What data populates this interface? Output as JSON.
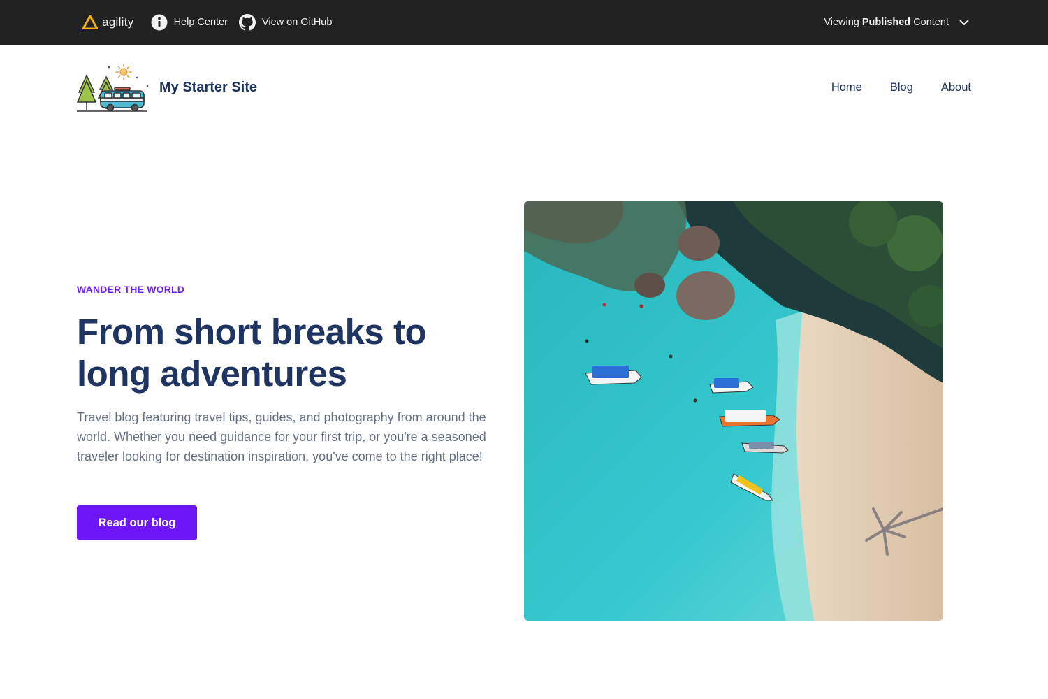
{
  "topbar": {
    "brand": "agility",
    "help_label": "Help Center",
    "github_label": "View on GitHub",
    "viewing_prefix": "Viewing",
    "viewing_mode": "Published",
    "viewing_suffix": "Content",
    "icons": {
      "help": "info-icon",
      "github": "github-icon",
      "dropdown": "chevron-down-icon"
    }
  },
  "site": {
    "name": "My Starter Site",
    "logo_icon": "camper-van-logo"
  },
  "nav": [
    {
      "label": "Home"
    },
    {
      "label": "Blog"
    },
    {
      "label": "About"
    }
  ],
  "hero": {
    "eyebrow": "WANDER THE WORLD",
    "title_line1": "From short breaks to",
    "title_line2": "long adventures",
    "description": "Travel blog featuring travel tips, guides, and photography from around the world. Whether you need guidance for your first trip, or you're a seasoned traveler looking for destination inspiration, you've come to the right place!",
    "cta_label": "Read our blog",
    "image_subject": "aerial-beach-with-boats"
  },
  "colors": {
    "topbar_bg": "#222222",
    "heading": "#1f3460",
    "accent": "#6d16f6",
    "body_text": "#667085",
    "water": "#2fc4c9",
    "sand": "#e3cdb4"
  }
}
